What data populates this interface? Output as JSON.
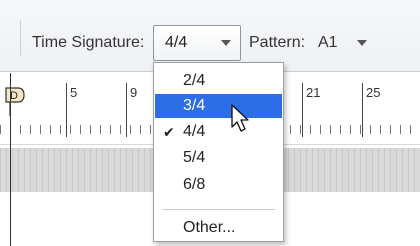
{
  "toolbar": {
    "time_signature_label": "Time Signature:",
    "time_signature_value": "4/4",
    "pattern_label": "Pattern:",
    "pattern_value": "A1"
  },
  "ruler": {
    "bar_numbers": [
      "5",
      "9",
      "21",
      "25"
    ],
    "playhead_mark": "D"
  },
  "menu": {
    "items": [
      {
        "label": "2/4",
        "checked": false,
        "highlighted": false
      },
      {
        "label": "3/4",
        "checked": false,
        "highlighted": true
      },
      {
        "label": "4/4",
        "checked": true,
        "highlighted": false
      },
      {
        "label": "5/4",
        "checked": false,
        "highlighted": false
      },
      {
        "label": "6/8",
        "checked": false,
        "highlighted": false
      }
    ],
    "other_label": "Other...",
    "check_glyph": "✔"
  },
  "colors": {
    "highlight": "#2b6ee6",
    "track": "#d9d9d9"
  }
}
